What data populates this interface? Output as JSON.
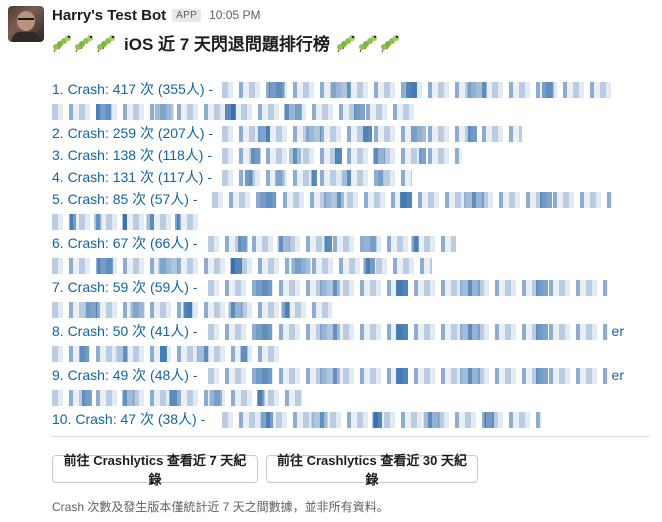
{
  "message": {
    "bot_name": "Harry's Test Bot",
    "badge": "APP",
    "time": "10:05 PM",
    "title": "iOS 近 7 天閃退問題排行榜",
    "icon": "caterpillar-icon"
  },
  "crashes": [
    {
      "label": "1. Crash: 417 次 (355人) -",
      "tall": true
    },
    {
      "label": "2. Crash: 259 次 (207人) -",
      "tall": false
    },
    {
      "label": "3. Crash: 138 次 (118人) -",
      "tall": false
    },
    {
      "label": "4. Crash: 131 次 (117人) -",
      "tall": false
    },
    {
      "label": "5. Crash: 85 次 (57人) -",
      "tall": true
    },
    {
      "label": "6. Crash: 67 次 (66人) -",
      "tall": true
    },
    {
      "label": "7. Crash: 59 次 (59人) -",
      "tall": true
    },
    {
      "label": "8. Crash: 50 次 (41人) -",
      "tall": true,
      "tail": "er"
    },
    {
      "label": "9. Crash: 49 次 (48人) -",
      "tall": true,
      "tail": "er"
    },
    {
      "label": "10. Crash: 47 次 (38人) -",
      "tall": false
    }
  ],
  "buttons": {
    "seven_days": "前往 Crashlytics 查看近 7 天紀錄",
    "thirty_days": "前往 Crashlytics 查看近 30 天紀錄"
  },
  "footer": "Crash 次數及發生版本僅統計近 7 天之間數據，並非所有資料。",
  "colors": {
    "link": "#1264a3",
    "text": "#1d1c1d",
    "muted": "#616061"
  }
}
